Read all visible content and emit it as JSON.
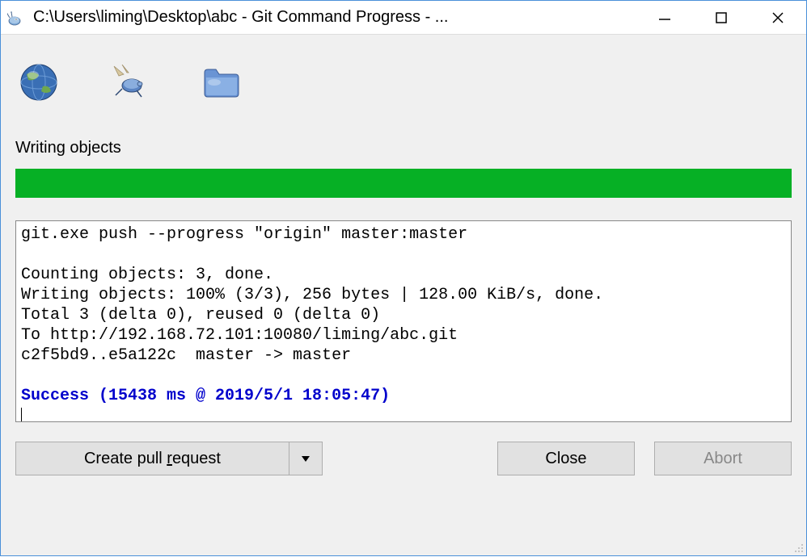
{
  "window": {
    "title": "C:\\Users\\liming\\Desktop\\abc - Git Command Progress - ..."
  },
  "status": {
    "label": "Writing objects",
    "progress_percent": 100
  },
  "output": {
    "line1": "git.exe push --progress \"origin\" master:master",
    "line2": "",
    "line3": "Counting objects: 3, done.",
    "line4": "Writing objects: 100% (3/3), 256 bytes | 128.00 KiB/s, done.",
    "line5": "Total 3 (delta 0), reused 0 (delta 0)",
    "line6": "To http://192.168.72.101:10080/liming/abc.git",
    "line7": "c2f5bd9..e5a122c  master -> master",
    "line8": "",
    "success": "Success (15438 ms @ 2019/5/1 18:05:47)"
  },
  "buttons": {
    "pull_request_prefix": "Create pull ",
    "pull_request_u": "r",
    "pull_request_suffix": "equest",
    "close": "Close",
    "abort": "Abort"
  }
}
